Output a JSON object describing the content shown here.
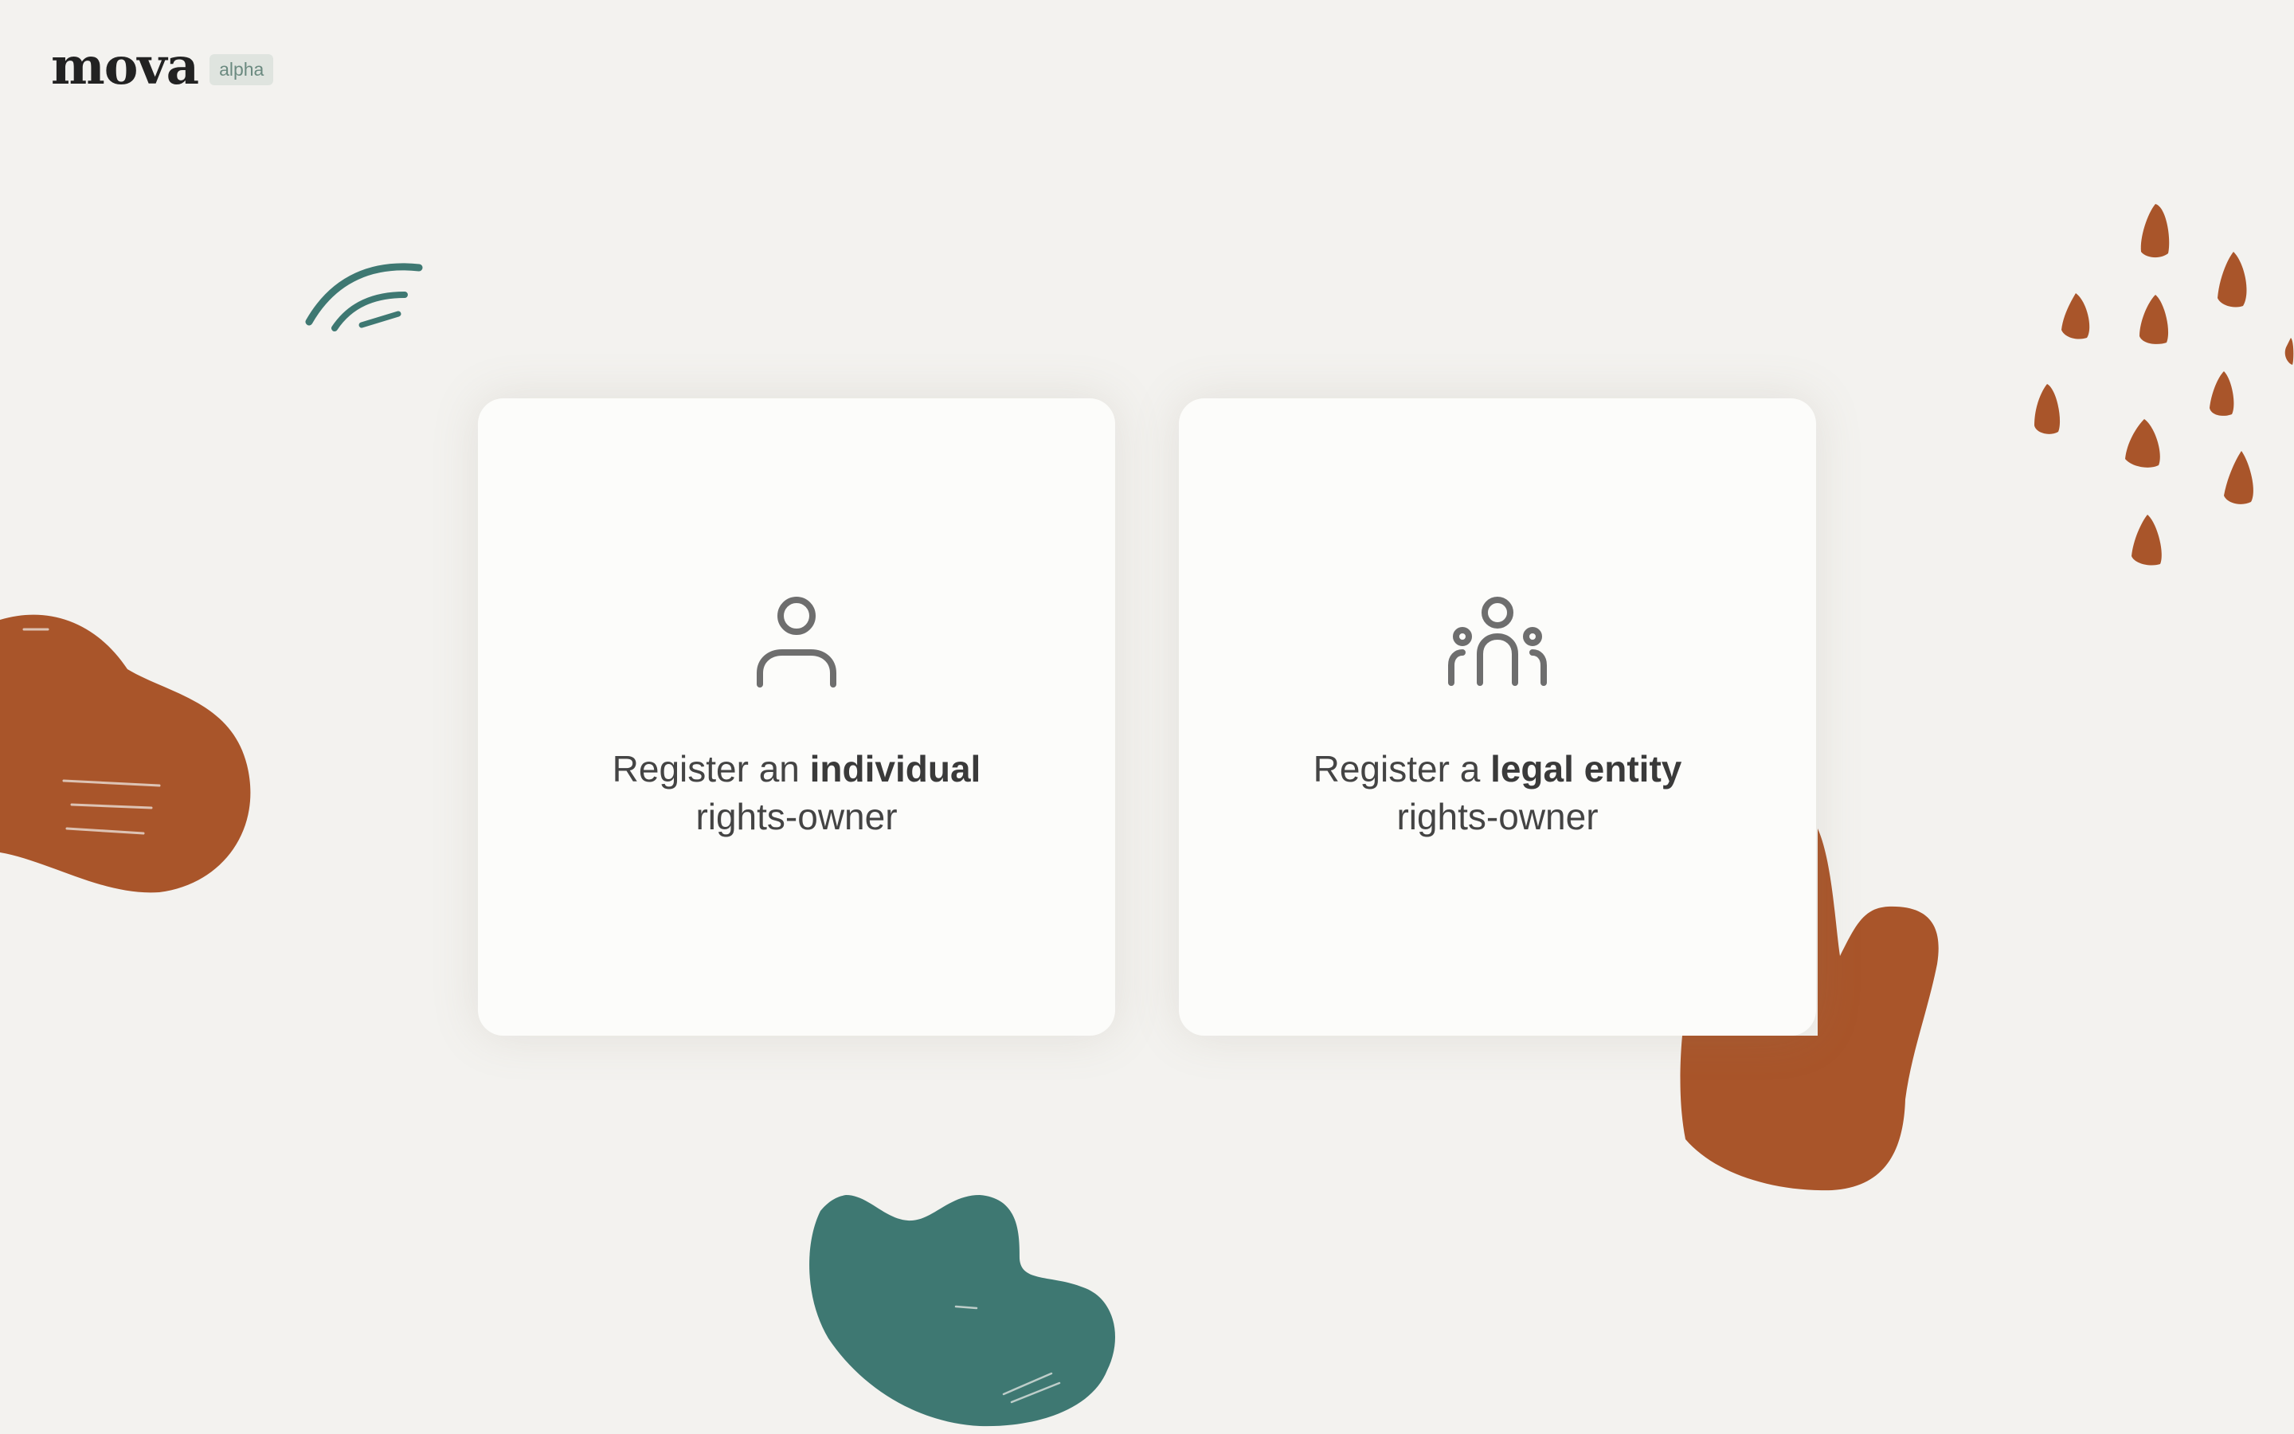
{
  "header": {
    "logo_text": "mova",
    "badge": "alpha"
  },
  "cards": [
    {
      "icon": "person-icon",
      "prefix": "Register an ",
      "emphasis": "individual",
      "suffix": "rights-owner"
    },
    {
      "icon": "group-icon",
      "prefix": "Register a ",
      "emphasis": "legal entity",
      "suffix": "rights-owner"
    }
  ],
  "colors": {
    "background": "#f3f2ef",
    "card": "#fcfcfa",
    "accent_rust": "#a9552a",
    "accent_teal": "#3e7872",
    "icon": "#6e6e6e",
    "text": "#444444"
  }
}
